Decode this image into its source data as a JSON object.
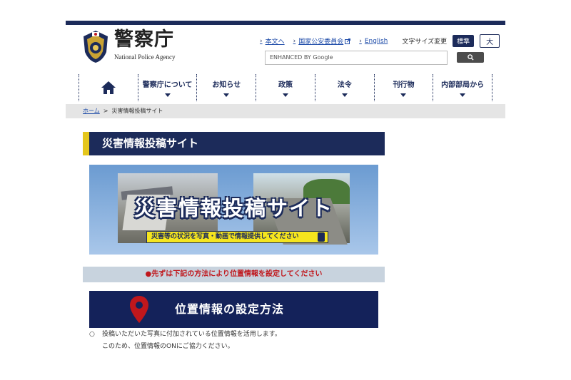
{
  "header": {
    "logo_jp": "警察庁",
    "logo_en": "National Police Agency",
    "links": [
      {
        "label": "本文へ"
      },
      {
        "label": "国家公安委員会"
      },
      {
        "label": "English"
      }
    ],
    "font_size_label": "文字サイズ変更",
    "font_std": "標準",
    "font_big": "大",
    "search_placeholder": "ENHANCED BY Google"
  },
  "nav": {
    "home_icon": "home-icon",
    "items": [
      {
        "label": "警察庁について"
      },
      {
        "label": "お知らせ"
      },
      {
        "label": "政策"
      },
      {
        "label": "法令"
      },
      {
        "label": "刊行物"
      },
      {
        "label": "内部部局から"
      }
    ]
  },
  "breadcrumb": {
    "home": "ホーム",
    "separator": ">",
    "current": "災害情報投稿サイト"
  },
  "main": {
    "title": "災害情報投稿サイト",
    "banner_title": "災害情報投稿サイト",
    "banner_sub": "災害等の状況を写真・動画で情報提供してください",
    "notice": "●先ずは下記の方法により位置情報を設定してください",
    "loc_title": "位置情報の設定方法",
    "body_bullet": "○",
    "body_line1": "投稿いただいた写真に付加されている位置情報を活用します。",
    "body_line2": "このため、位置情報のONにご協力ください。"
  },
  "colors": {
    "navy": "#1c2b5a",
    "accent_yellow": "#e5c71d",
    "notice_red": "#c0171c"
  }
}
